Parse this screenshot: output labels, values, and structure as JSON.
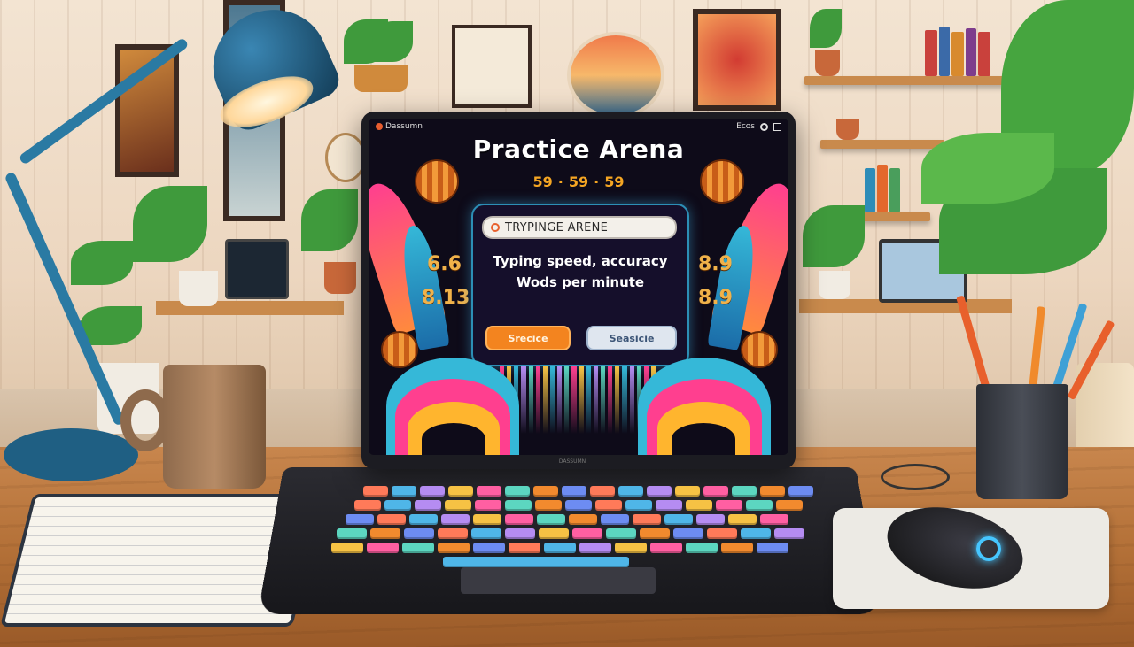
{
  "screen": {
    "brand_label": "Dassumn",
    "top_right_label": "Ecos",
    "title": "Practice Arena",
    "counters": [
      "59",
      "59",
      "59"
    ],
    "left_numbers": [
      "6.6",
      "8.13"
    ],
    "right_numbers": [
      "8.9",
      "8.9"
    ],
    "search_placeholder": "TRYPINGE ARENE",
    "line1": "Typing speed, accuracy",
    "line2": "Wods per minute",
    "primary_button": "Srecice",
    "secondary_button": "Seasicie"
  },
  "laptop": {
    "base_label": "DASSUMN"
  },
  "colors": {
    "accent_orange": "#f3841f",
    "accent_blue": "#2c8fb6",
    "pink": "#ff3f8f",
    "teal": "#35b8d8"
  }
}
